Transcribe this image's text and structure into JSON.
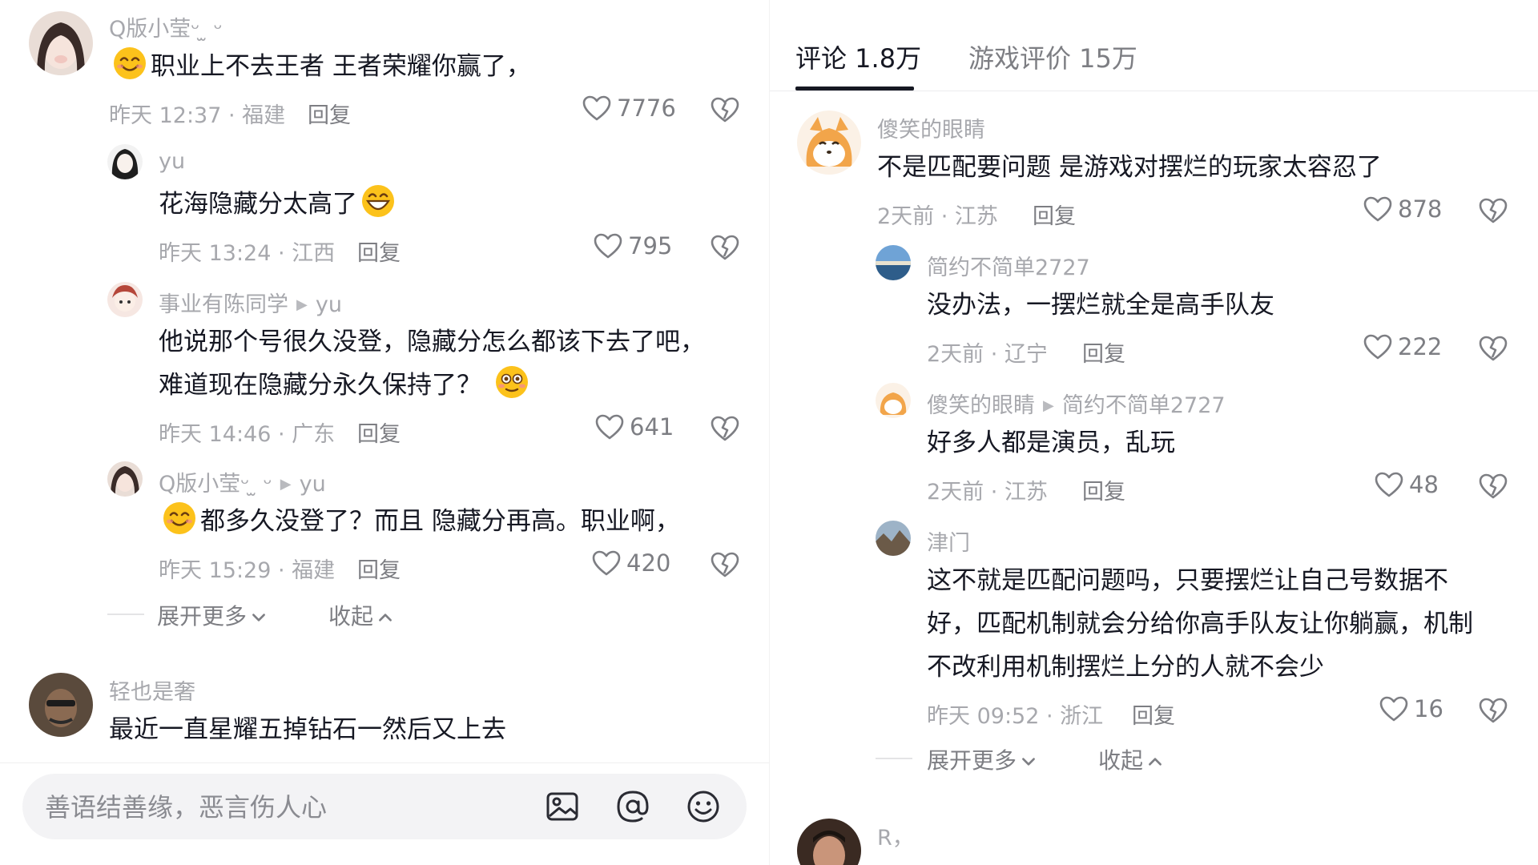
{
  "left": {
    "comments": [
      {
        "user": "Q版小莹ᵕ ̫ ᵕ",
        "text": "职业上不去王者 王者荣耀你赢了，",
        "time": "昨天 12:37 · 福建",
        "reply": "回复",
        "likes": "7776"
      },
      {
        "user": "yu",
        "text": "花海隐藏分太高了",
        "time": "昨天 13:24 · 江西",
        "reply": "回复",
        "likes": "795"
      },
      {
        "user": "事业有陈同学",
        "reply_to": "yu",
        "text_line1": "他说那个号很久没登，隐藏分怎么都该下去了吧，",
        "text_line2": "难道现在隐藏分永久保持了？",
        "time": "昨天 14:46 · 广东",
        "reply": "回复",
        "likes": "641"
      },
      {
        "user": "Q版小莹ᵕ ̫ ᵕ",
        "reply_to": "yu",
        "text": "都多久没登了？而且 隐藏分再高。职业啊，",
        "time": "昨天 15:29 · 福建",
        "reply": "回复",
        "likes": "420"
      },
      {
        "user": "轻也是奢",
        "text": "最近一直星耀五掉钻石一然后又上去"
      }
    ],
    "expand_more": "展开更多",
    "collapse": "收起",
    "input_placeholder": "善语结善缘，恶言伤人心"
  },
  "right": {
    "tabs": [
      {
        "label": "评论 1.8万",
        "active": true
      },
      {
        "label": "游戏评价 15万",
        "active": false
      }
    ],
    "comments": [
      {
        "user": "傻笑的眼睛",
        "text": "不是匹配要问题 是游戏对摆烂的玩家太容忍了",
        "time": "2天前 · 江苏",
        "reply": "回复",
        "likes": "878"
      },
      {
        "user": "简约不简单2727",
        "text": "没办法，一摆烂就全是高手队友",
        "time": "2天前 · 辽宁",
        "reply": "回复",
        "likes": "222"
      },
      {
        "user": "傻笑的眼睛",
        "reply_to": "简约不简单2727",
        "text": "好多人都是演员，乱玩",
        "time": "2天前 · 江苏",
        "reply": "回复",
        "likes": "48"
      },
      {
        "user": "津门",
        "text_line1": "这不就是匹配问题吗，只要摆烂让自己号数据不",
        "text_line2": "好，匹配机制就会分给你高手队友让你躺赢，机制",
        "text_line3": "不改利用机制摆烂上分的人就不会少",
        "time": "昨天 09:52 · 浙江",
        "reply": "回复",
        "likes": "16"
      },
      {
        "user": "R，"
      }
    ],
    "expand_more": "展开更多",
    "collapse": "收起"
  },
  "icons": [
    "heart-icon",
    "dislike-heart-icon",
    "image-icon",
    "at-icon",
    "emoji-icon",
    "chevron-down-icon",
    "chevron-up-icon",
    "reply-arrow-icon"
  ],
  "colors": {
    "text": "#161823",
    "secondary": "#a7a8ad",
    "action": "#7d7e83",
    "input_bg": "#f3f3f5"
  }
}
